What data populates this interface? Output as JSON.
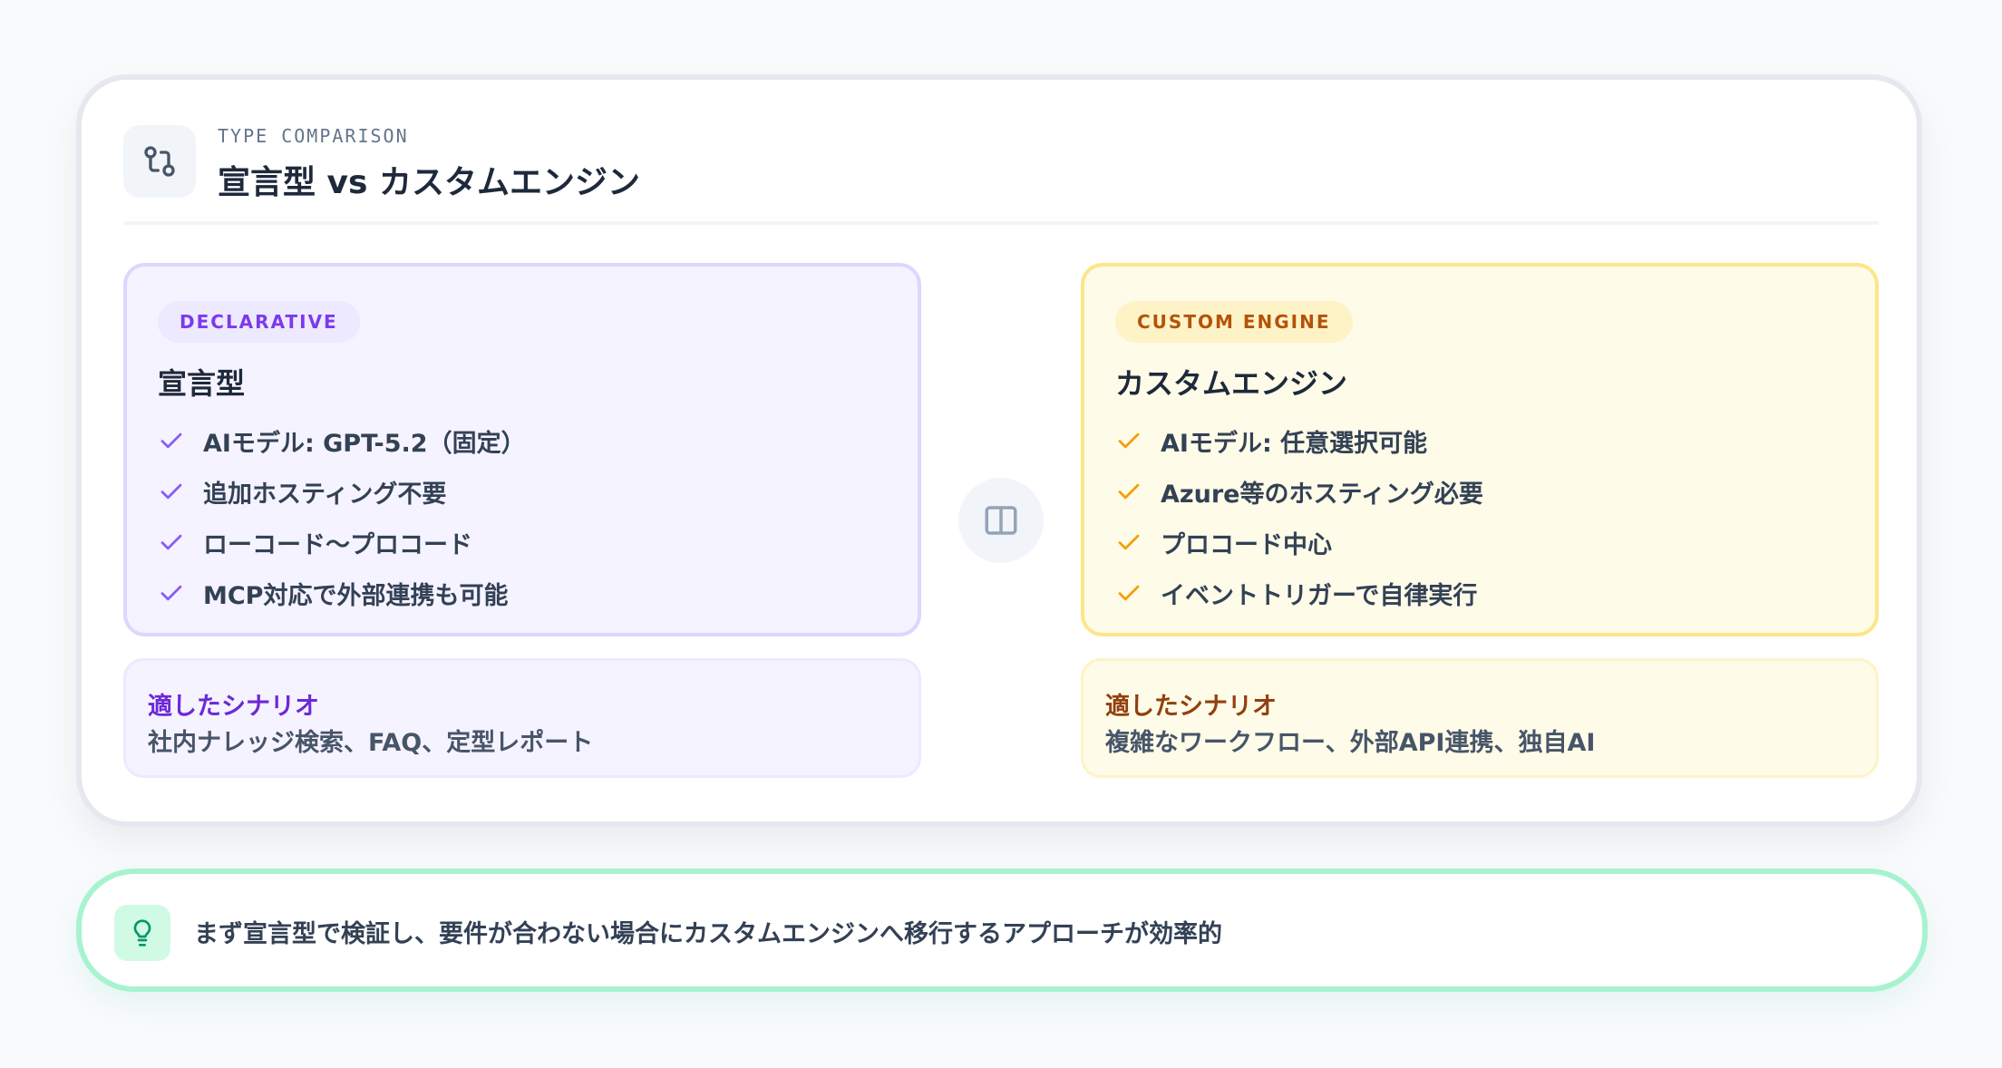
{
  "header": {
    "eyebrow": "TYPE COMPARISON",
    "title": "宣言型 vs カスタムエンジン",
    "icon": "git-compare-icon"
  },
  "declarative": {
    "badge": "DECLARATIVE",
    "title": "宣言型",
    "accent": "#8b5cf6",
    "items": [
      {
        "label": "AIモデル: GPT-5.2（固定）"
      },
      {
        "label": "追加ホスティング不要"
      },
      {
        "label": "ローコード〜プロコード"
      },
      {
        "label": "MCP対応で外部連携も可能"
      }
    ],
    "scenario_label": "適したシナリオ",
    "scenario_text": "社内ナレッジ検索、FAQ、定型レポート"
  },
  "custom": {
    "badge": "CUSTOM ENGINE",
    "title": "カスタムエンジン",
    "accent": "#f59e0b",
    "items": [
      {
        "label": "AIモデル: 任意選択可能"
      },
      {
        "label": "Azure等のホスティング必要"
      },
      {
        "label": "プロコード中心"
      },
      {
        "label": "イベントトリガーで自律実行"
      }
    ],
    "scenario_label": "適したシナリオ",
    "scenario_text": "複雑なワークフロー、外部API連携、独自AI"
  },
  "center_icon": "columns-icon",
  "tip": {
    "icon": "lightbulb-icon",
    "text": "まず宣言型で検証し、要件が合わない場合にカスタムエンジンへ移行するアプローチが効率的"
  }
}
